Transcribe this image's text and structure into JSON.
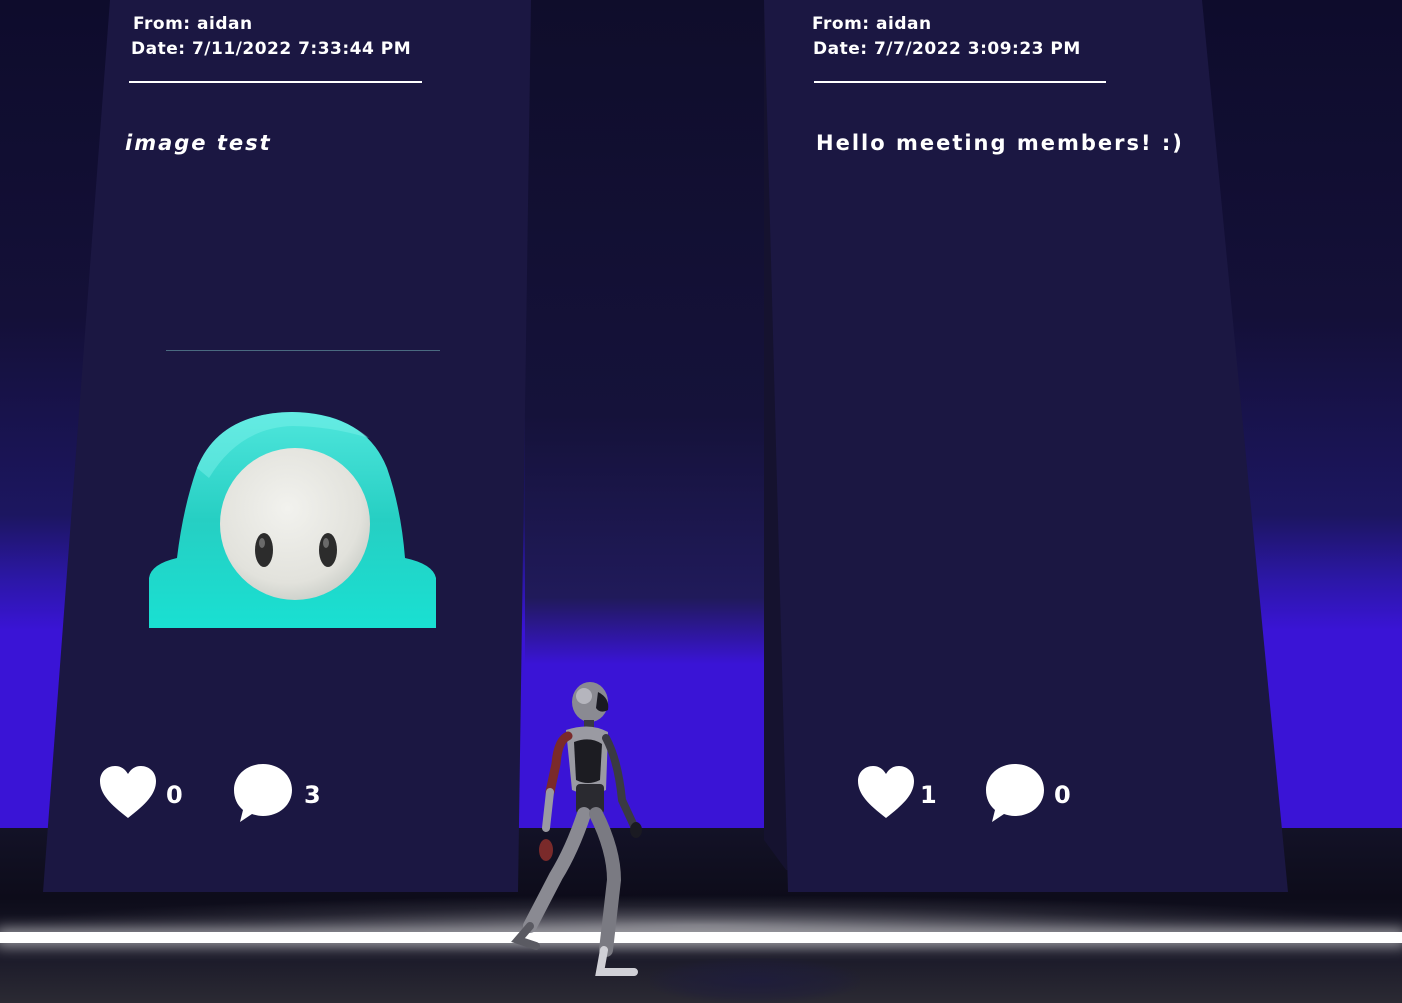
{
  "posts": [
    {
      "from": "From: aidan",
      "date": "Date: 7/11/2022 7:33:44 PM",
      "message": "image test",
      "has_image": true,
      "likes": "0",
      "comments": "3"
    },
    {
      "from": "From: aidan",
      "date": "Date: 7/7/2022 3:09:23 PM",
      "message": "Hello meeting members! :)",
      "has_image": false,
      "likes": "1",
      "comments": "0"
    }
  ],
  "icons": {
    "like": "heart-icon",
    "comment": "speech-bubble-icon"
  },
  "colors": {
    "panel": "#1b1742",
    "neon_wall": "#3a14d6",
    "image_character": "#2bd4c8",
    "text": "#ffffff"
  }
}
